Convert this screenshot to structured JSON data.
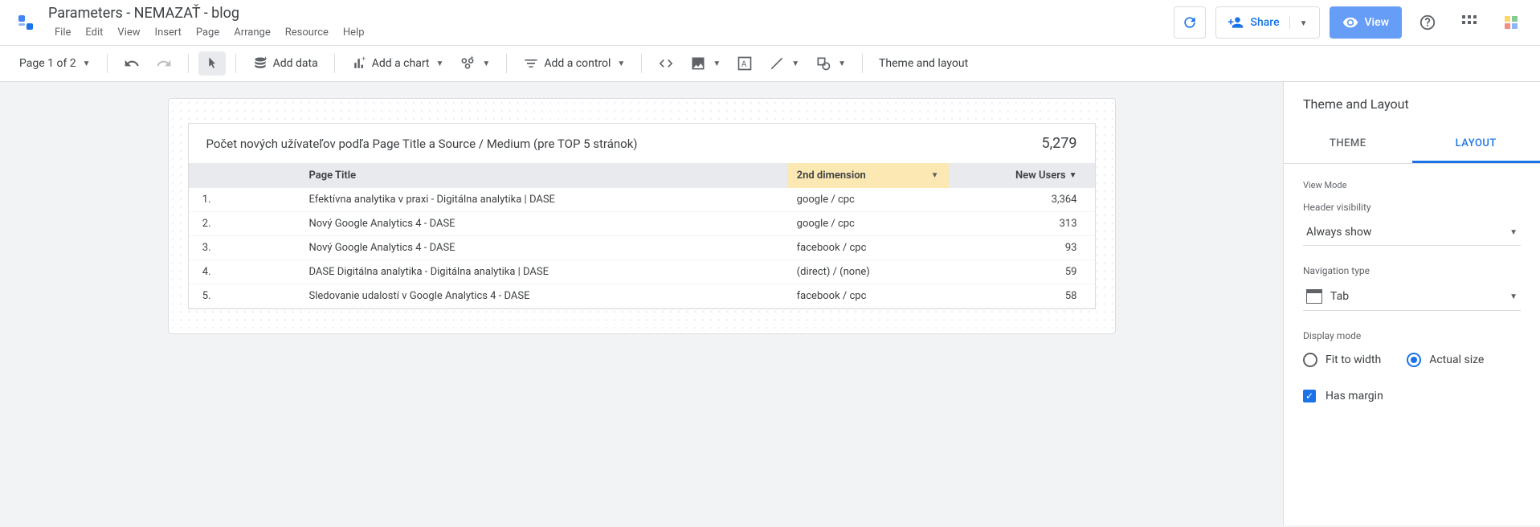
{
  "doc_title": "Parameters - NEMAZAŤ - blog",
  "menu": [
    "File",
    "Edit",
    "View",
    "Insert",
    "Page",
    "Arrange",
    "Resource",
    "Help"
  ],
  "header_actions": {
    "share": "Share",
    "view": "View"
  },
  "toolbar": {
    "page_selector": "Page 1 of 2",
    "add_data": "Add data",
    "add_chart": "Add a chart",
    "add_control": "Add a control",
    "theme_layout": "Theme and layout"
  },
  "chart_data": {
    "type": "table",
    "title": "Počet nových užívateľov podľa Page Title a Source / Medium (pre TOP 5 stránok)",
    "total": "5,279",
    "columns": [
      "Page Title",
      "2nd dimension",
      "New Users"
    ],
    "rows": [
      {
        "n": "1.",
        "page": "Efektívna analytika v praxi - Digitálna analytika | DASE",
        "dim": "google / cpc",
        "users": "3,364"
      },
      {
        "n": "2.",
        "page": "Nový Google Analytics 4 - DASE",
        "dim": "google / cpc",
        "users": "313"
      },
      {
        "n": "3.",
        "page": "Nový Google Analytics 4 - DASE",
        "dim": "facebook / cpc",
        "users": "93"
      },
      {
        "n": "4.",
        "page": "DASE Digitálna analytika - Digitálna analytika | DASE",
        "dim": "(direct) / (none)",
        "users": "59"
      },
      {
        "n": "5.",
        "page": "Sledovanie udalostí v Google Analytics 4 - DASE",
        "dim": "facebook / cpc",
        "users": "58"
      }
    ]
  },
  "sidebar": {
    "title": "Theme and Layout",
    "tabs": {
      "theme": "THEME",
      "layout": "LAYOUT"
    },
    "view_mode_label": "View Mode",
    "header_visibility": {
      "label": "Header visibility",
      "value": "Always show"
    },
    "navigation_type": {
      "label": "Navigation type",
      "value": "Tab"
    },
    "display_mode": {
      "label": "Display mode",
      "fit": "Fit to width",
      "actual": "Actual size"
    },
    "has_margin": "Has margin"
  }
}
